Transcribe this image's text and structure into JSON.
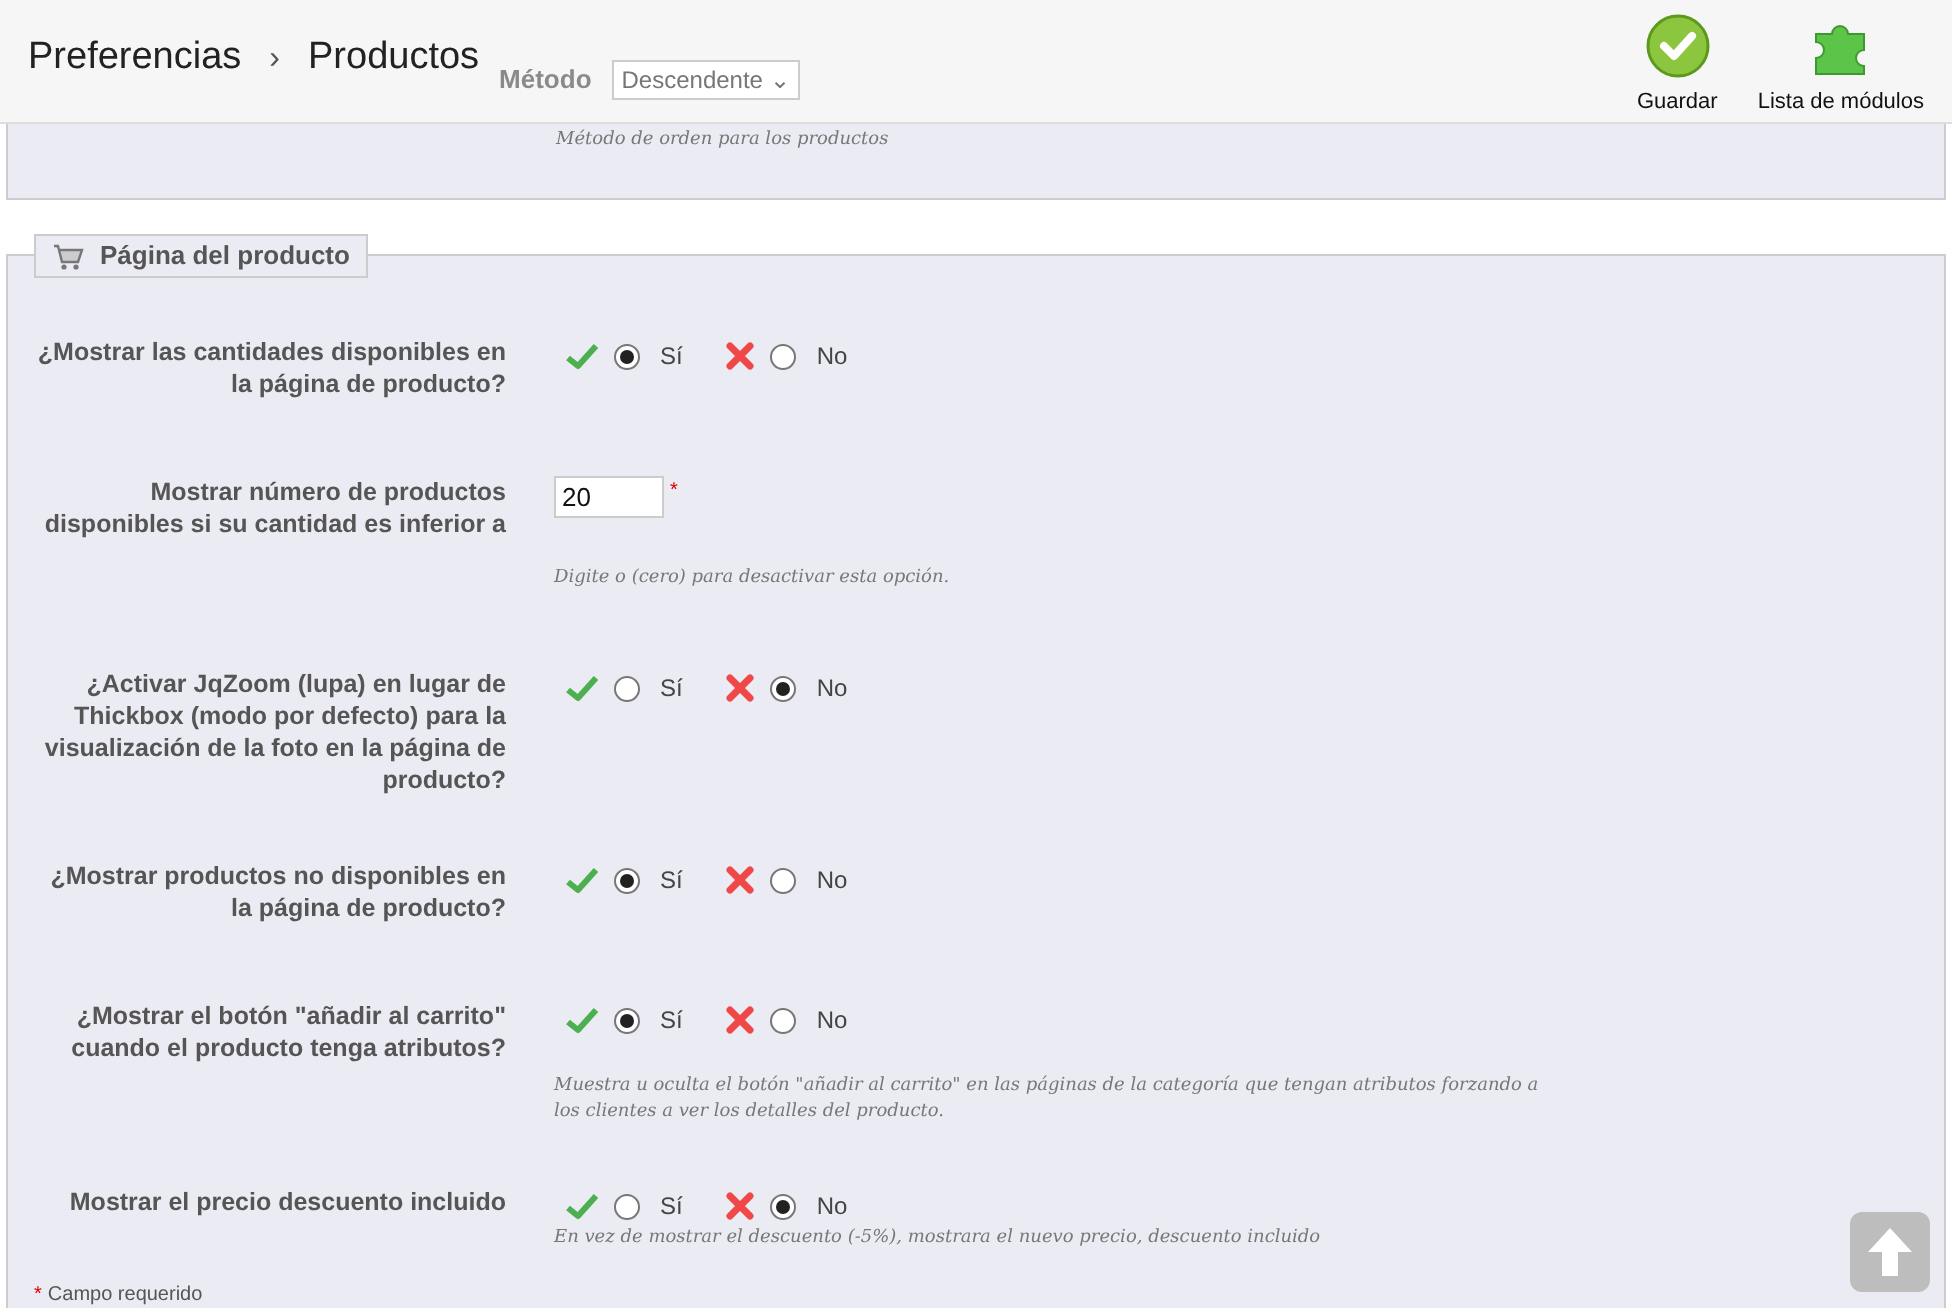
{
  "breadcrumb": [
    "Preferencias",
    "Productos"
  ],
  "breadcrumb_separator": "›",
  "required_mark": "*",
  "toolbar": [
    {
      "kind": "save",
      "label": "Guardar"
    },
    {
      "kind": "modules",
      "label": "Lista de módulos"
    }
  ],
  "previous_row": {
    "label": "Método",
    "value": "Descendente",
    "caret": "⌄",
    "hint": "Método de orden para los productos"
  },
  "section": {
    "title": "Página del producto",
    "fields": [
      {
        "kind": "radio",
        "label": "¿Mostrar las cantidades disponibles en la página de producto?",
        "options": [
          {
            "label": "Sí",
            "selected": true
          },
          {
            "label": "No",
            "selected": false
          }
        ]
      },
      {
        "kind": "number",
        "label": "Mostrar número de productos disponibles si su cantidad es inferior a",
        "value": "20",
        "required": true,
        "hint": "Digite o (cero) para desactivar esta opción."
      },
      {
        "kind": "radio",
        "label": "¿Activar JqZoom (lupa) en lugar de Thickbox (modo por defecto) para la visualización de la foto en la página de producto?",
        "options": [
          {
            "label": "Sí",
            "selected": false
          },
          {
            "label": "No",
            "selected": true
          }
        ]
      },
      {
        "kind": "radio",
        "label": "¿Mostrar productos no disponibles en la página de producto?",
        "options": [
          {
            "label": "Sí",
            "selected": true
          },
          {
            "label": "No",
            "selected": false
          }
        ]
      },
      {
        "kind": "radio",
        "label": "¿Mostrar el botón \"añadir al carrito\" cuando el producto tenga atributos?",
        "options": [
          {
            "label": "Sí",
            "selected": true
          },
          {
            "label": "No",
            "selected": false
          }
        ],
        "hint": "Muestra u oculta el botón \"añadir al carrito\" en las páginas de la categoría que tengan atributos forzando a los clientes a ver los detalles del producto."
      },
      {
        "kind": "radio",
        "label": "Mostrar el precio descuento incluido",
        "options": [
          {
            "label": "Sí",
            "selected": false
          },
          {
            "label": "No",
            "selected": true
          }
        ],
        "hint": "En vez de mostrar el descuento (-5%), mostrara el nuevo precio, descuento incluido"
      }
    ],
    "footnote": "Campo requerido"
  }
}
